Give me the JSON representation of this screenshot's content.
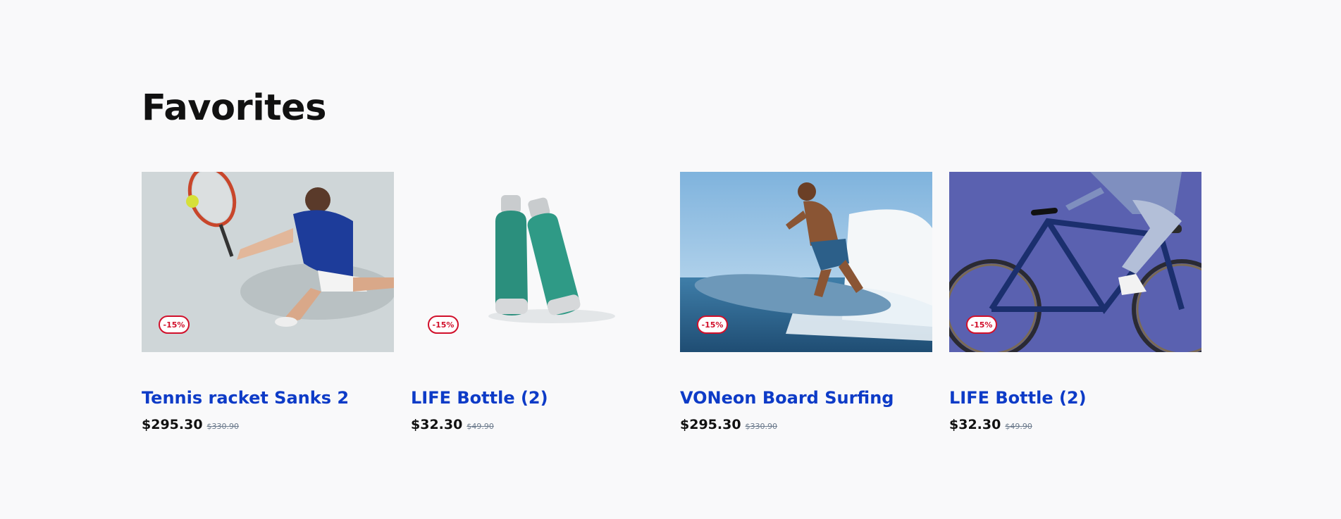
{
  "section": {
    "title": "Favorites"
  },
  "products": [
    {
      "name": "Tennis racket Sanks 2",
      "price": "$295.30",
      "old_price": "$330.90",
      "discount": "-15%",
      "image_icon": "tennis-player-image"
    },
    {
      "name": "LIFE Bottle (2)",
      "price": "$32.30",
      "old_price": "$49.90",
      "discount": "-15%",
      "image_icon": "bottles-image"
    },
    {
      "name": "VONeon Board Surfing",
      "price": "$295.30",
      "old_price": "$330.90",
      "discount": "-15%",
      "image_icon": "surfer-image"
    },
    {
      "name": "LIFE Bottle (2)",
      "price": "$32.30",
      "old_price": "$49.90",
      "discount": "-15%",
      "image_icon": "cyclist-image"
    }
  ],
  "colors": {
    "accent": "#0d3bc7",
    "discount": "#d1102b",
    "background": "#f9f9fa"
  }
}
